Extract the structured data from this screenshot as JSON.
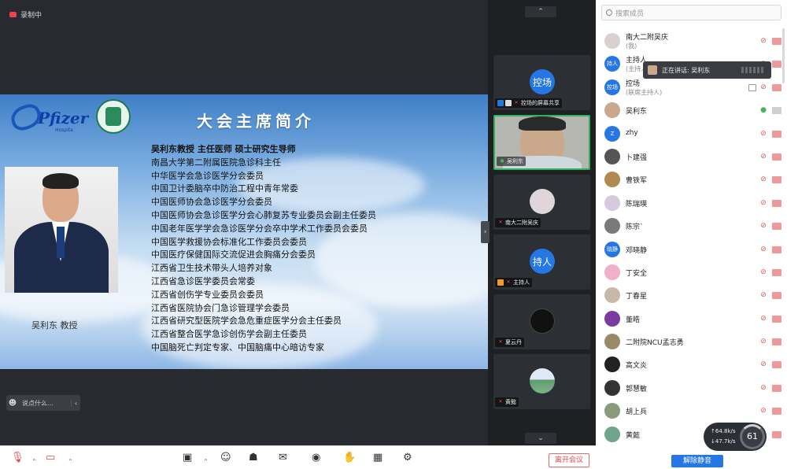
{
  "recording": {
    "label": "录制中"
  },
  "slide": {
    "logo_word": "Pfizer",
    "logo_sub": "Hospita",
    "title": "大会主席简介",
    "caption": "吴利东 教授",
    "bio_lines": [
      "吴利东教授  主任医师  硕士研究生导师",
      "南昌大学第二附属医院急诊科主任",
      "中华医学会急诊医学分会委员",
      "中国卫计委脑卒中防治工程中青年常委",
      "中国医师协会急诊医学分会委员",
      "中国医师协会急诊医学分会心肺复苏专业委员会副主任委员",
      "中国老年医学学会急诊医学分会卒中学术工作委员会委员",
      "中国医学救援协会标准化工作委员会委员",
      "中国医疗保健国际交流促进会胸痛分会委员",
      "江西省卫生技术带头人培养对象",
      "江西省急诊医学委员会常委",
      "江西省创伤学专业委员会委员",
      "江西省医院协会门急诊管理学会委员",
      "江西省研究型医院学会急危重症医学分会主任委员",
      "江西省整合医学急诊创伤学会副主任委员",
      "中国脑死亡判定专家、中国脑痛中心暗访专家"
    ]
  },
  "chat": {
    "placeholder": "说点什么..."
  },
  "video_strip": {
    "tiles": [
      {
        "avatar": "控场",
        "label": "控场的屏幕共享",
        "color": "#2577e3"
      },
      {
        "avatar": "",
        "label": "吴利东",
        "color": "#d0bfb0"
      },
      {
        "avatar": "",
        "label": "南大二附吴庆",
        "color": "#ded6d8"
      },
      {
        "avatar": "持人",
        "label": "主持人",
        "color": "#2577e3"
      },
      {
        "avatar": "",
        "label": "夏云丹",
        "color": "#111"
      },
      {
        "avatar": "",
        "label": "黄懿",
        "color": "#6fa58a"
      }
    ]
  },
  "participants": {
    "search_placeholder": "搜索成员",
    "list": [
      {
        "name": "南大二附吴庆",
        "role": "(我)",
        "avatar": "",
        "color": "#d9d0d0",
        "mic": "off"
      },
      {
        "name": "主持人",
        "role": "(主持人)",
        "avatar": "持人",
        "color": "#2577e3",
        "mic": "off"
      },
      {
        "name": "控场",
        "role": "(联席主持人)",
        "avatar": "控场",
        "color": "#2577e3",
        "mic": "off"
      },
      {
        "name": "吴利东",
        "role": "",
        "avatar": "",
        "color": "#c9a88c",
        "mic": "on"
      },
      {
        "name": "zhy",
        "role": "",
        "avatar": "Z",
        "color": "#2577e3",
        "mic": "off"
      },
      {
        "name": "卜建强",
        "role": "",
        "avatar": "",
        "color": "#555",
        "mic": "off"
      },
      {
        "name": "曹铁军",
        "role": "",
        "avatar": "",
        "color": "#b08a50",
        "mic": "off"
      },
      {
        "name": "陈瑞瑛",
        "role": "",
        "avatar": "",
        "color": "#d8c8e0",
        "mic": "off"
      },
      {
        "name": "陈宗`",
        "role": "",
        "avatar": "",
        "color": "#7a7a7a",
        "mic": "off"
      },
      {
        "name": "邓晓静",
        "role": "",
        "avatar": "晓静",
        "color": "#2577e3",
        "mic": "off"
      },
      {
        "name": "丁安全",
        "role": "",
        "avatar": "",
        "color": "#f0b0c8",
        "mic": "off"
      },
      {
        "name": "丁春星",
        "role": "",
        "avatar": "",
        "color": "#c8b8a8",
        "mic": "off"
      },
      {
        "name": "董皓",
        "role": "",
        "avatar": "",
        "color": "#7a3aa0",
        "mic": "off"
      },
      {
        "name": "二附院NCU孟志勇",
        "role": "",
        "avatar": "",
        "color": "#9a8a6a",
        "mic": "off"
      },
      {
        "name": "高文炎",
        "role": "",
        "avatar": "",
        "color": "#222",
        "mic": "off"
      },
      {
        "name": "郭慧敏",
        "role": "",
        "avatar": "",
        "color": "#333",
        "mic": "off"
      },
      {
        "name": "胡上兵",
        "role": "",
        "avatar": "",
        "color": "#8a9a7a",
        "mic": "off"
      },
      {
        "name": "黄懿",
        "role": "",
        "avatar": "",
        "color": "#6fa58a",
        "mic": "off"
      }
    ],
    "unmute_label": "解除静音"
  },
  "speaking": {
    "label": "正在讲话: 吴利东"
  },
  "network": {
    "up": "↑64.8k/s",
    "down": "↓47.7k/s",
    "percent": "61"
  },
  "toolbar": {
    "leave_label": "离开会议"
  }
}
